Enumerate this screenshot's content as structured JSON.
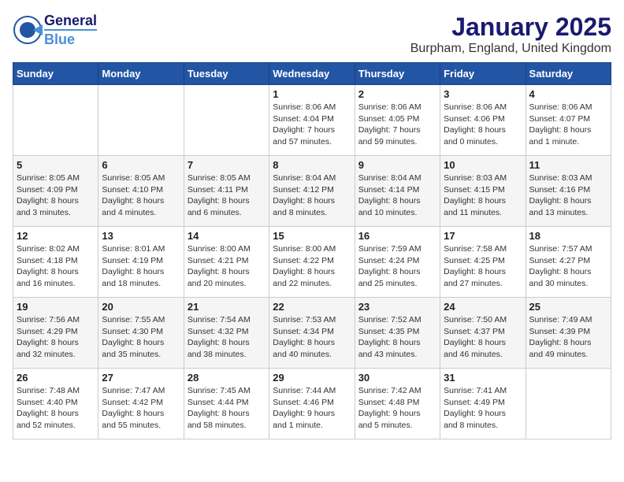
{
  "header": {
    "logo": {
      "line1": "General",
      "line2": "Blue"
    },
    "title": "January 2025",
    "subtitle": "Burpham, England, United Kingdom"
  },
  "weekdays": [
    "Sunday",
    "Monday",
    "Tuesday",
    "Wednesday",
    "Thursday",
    "Friday",
    "Saturday"
  ],
  "weeks": [
    [
      {
        "day": "",
        "info": ""
      },
      {
        "day": "",
        "info": ""
      },
      {
        "day": "",
        "info": ""
      },
      {
        "day": "1",
        "info": "Sunrise: 8:06 AM\nSunset: 4:04 PM\nDaylight: 7 hours\nand 57 minutes."
      },
      {
        "day": "2",
        "info": "Sunrise: 8:06 AM\nSunset: 4:05 PM\nDaylight: 7 hours\nand 59 minutes."
      },
      {
        "day": "3",
        "info": "Sunrise: 8:06 AM\nSunset: 4:06 PM\nDaylight: 8 hours\nand 0 minutes."
      },
      {
        "day": "4",
        "info": "Sunrise: 8:06 AM\nSunset: 4:07 PM\nDaylight: 8 hours\nand 1 minute."
      }
    ],
    [
      {
        "day": "5",
        "info": "Sunrise: 8:05 AM\nSunset: 4:09 PM\nDaylight: 8 hours\nand 3 minutes."
      },
      {
        "day": "6",
        "info": "Sunrise: 8:05 AM\nSunset: 4:10 PM\nDaylight: 8 hours\nand 4 minutes."
      },
      {
        "day": "7",
        "info": "Sunrise: 8:05 AM\nSunset: 4:11 PM\nDaylight: 8 hours\nand 6 minutes."
      },
      {
        "day": "8",
        "info": "Sunrise: 8:04 AM\nSunset: 4:12 PM\nDaylight: 8 hours\nand 8 minutes."
      },
      {
        "day": "9",
        "info": "Sunrise: 8:04 AM\nSunset: 4:14 PM\nDaylight: 8 hours\nand 10 minutes."
      },
      {
        "day": "10",
        "info": "Sunrise: 8:03 AM\nSunset: 4:15 PM\nDaylight: 8 hours\nand 11 minutes."
      },
      {
        "day": "11",
        "info": "Sunrise: 8:03 AM\nSunset: 4:16 PM\nDaylight: 8 hours\nand 13 minutes."
      }
    ],
    [
      {
        "day": "12",
        "info": "Sunrise: 8:02 AM\nSunset: 4:18 PM\nDaylight: 8 hours\nand 16 minutes."
      },
      {
        "day": "13",
        "info": "Sunrise: 8:01 AM\nSunset: 4:19 PM\nDaylight: 8 hours\nand 18 minutes."
      },
      {
        "day": "14",
        "info": "Sunrise: 8:00 AM\nSunset: 4:21 PM\nDaylight: 8 hours\nand 20 minutes."
      },
      {
        "day": "15",
        "info": "Sunrise: 8:00 AM\nSunset: 4:22 PM\nDaylight: 8 hours\nand 22 minutes."
      },
      {
        "day": "16",
        "info": "Sunrise: 7:59 AM\nSunset: 4:24 PM\nDaylight: 8 hours\nand 25 minutes."
      },
      {
        "day": "17",
        "info": "Sunrise: 7:58 AM\nSunset: 4:25 PM\nDaylight: 8 hours\nand 27 minutes."
      },
      {
        "day": "18",
        "info": "Sunrise: 7:57 AM\nSunset: 4:27 PM\nDaylight: 8 hours\nand 30 minutes."
      }
    ],
    [
      {
        "day": "19",
        "info": "Sunrise: 7:56 AM\nSunset: 4:29 PM\nDaylight: 8 hours\nand 32 minutes."
      },
      {
        "day": "20",
        "info": "Sunrise: 7:55 AM\nSunset: 4:30 PM\nDaylight: 8 hours\nand 35 minutes."
      },
      {
        "day": "21",
        "info": "Sunrise: 7:54 AM\nSunset: 4:32 PM\nDaylight: 8 hours\nand 38 minutes."
      },
      {
        "day": "22",
        "info": "Sunrise: 7:53 AM\nSunset: 4:34 PM\nDaylight: 8 hours\nand 40 minutes."
      },
      {
        "day": "23",
        "info": "Sunrise: 7:52 AM\nSunset: 4:35 PM\nDaylight: 8 hours\nand 43 minutes."
      },
      {
        "day": "24",
        "info": "Sunrise: 7:50 AM\nSunset: 4:37 PM\nDaylight: 8 hours\nand 46 minutes."
      },
      {
        "day": "25",
        "info": "Sunrise: 7:49 AM\nSunset: 4:39 PM\nDaylight: 8 hours\nand 49 minutes."
      }
    ],
    [
      {
        "day": "26",
        "info": "Sunrise: 7:48 AM\nSunset: 4:40 PM\nDaylight: 8 hours\nand 52 minutes."
      },
      {
        "day": "27",
        "info": "Sunrise: 7:47 AM\nSunset: 4:42 PM\nDaylight: 8 hours\nand 55 minutes."
      },
      {
        "day": "28",
        "info": "Sunrise: 7:45 AM\nSunset: 4:44 PM\nDaylight: 8 hours\nand 58 minutes."
      },
      {
        "day": "29",
        "info": "Sunrise: 7:44 AM\nSunset: 4:46 PM\nDaylight: 9 hours\nand 1 minute."
      },
      {
        "day": "30",
        "info": "Sunrise: 7:42 AM\nSunset: 4:48 PM\nDaylight: 9 hours\nand 5 minutes."
      },
      {
        "day": "31",
        "info": "Sunrise: 7:41 AM\nSunset: 4:49 PM\nDaylight: 9 hours\nand 8 minutes."
      },
      {
        "day": "",
        "info": ""
      }
    ]
  ]
}
